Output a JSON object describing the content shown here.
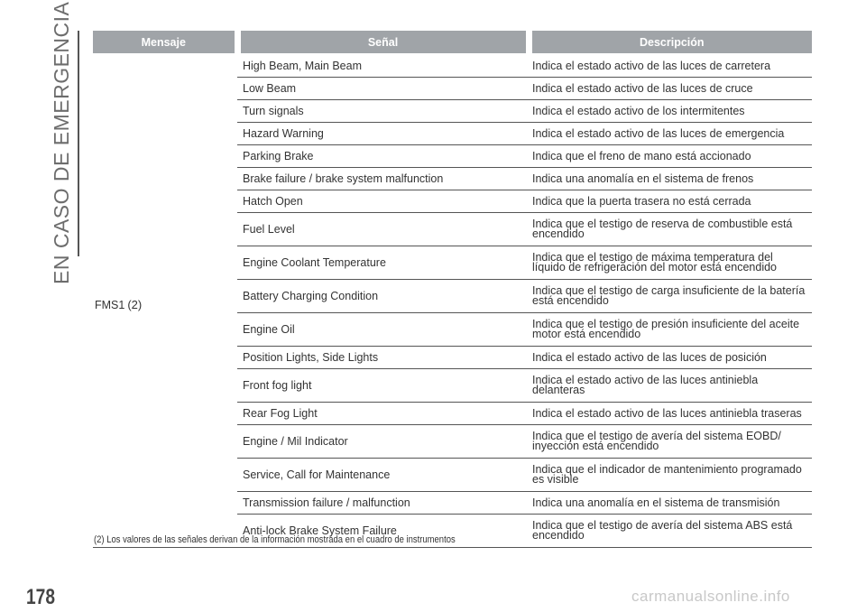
{
  "section_title": "EN CASO DE EMERGENCIA",
  "headers": [
    "Mensaje",
    "Señal",
    "Descripción"
  ],
  "message_label": "FMS1",
  "message_ref": "(2)",
  "rows": [
    {
      "signal": "High Beam, Main Beam",
      "description": "Indica el estado activo de las luces de carretera"
    },
    {
      "signal": "Low Beam",
      "description": "Indica el estado activo de las luces de cruce"
    },
    {
      "signal": "Turn signals",
      "description": "Indica el estado activo de los intermitentes"
    },
    {
      "signal": "Hazard Warning",
      "description": "Indica el estado activo de las luces de emergencia"
    },
    {
      "signal": "Parking Brake",
      "description": "Indica que el freno de mano está accionado"
    },
    {
      "signal": "Brake failure / brake system malfunction",
      "description": "Indica una anomalía en el sistema de frenos"
    },
    {
      "signal": "Hatch Open",
      "description": "Indica que la puerta trasera no está cerrada"
    },
    {
      "signal": "Fuel Level",
      "description": "Indica que el testigo de reserva de combustible está encendido"
    },
    {
      "signal": "Engine Coolant Temperature",
      "description": "Indica que el testigo de máxima temperatura del líquido de refrigeración del motor está encendido"
    },
    {
      "signal": "Battery Charging Condition",
      "description": "Indica que el testigo de carga insuficiente de la batería está encendido"
    },
    {
      "signal": "Engine Oil",
      "description": "Indica que el testigo de presión insuficiente del aceite motor está encendido"
    },
    {
      "signal": "Position Lights, Side Lights",
      "description": "Indica el estado activo de las luces de posición"
    },
    {
      "signal": "Front fog light",
      "description": "Indica el estado activo de las luces antiniebla delanteras"
    },
    {
      "signal": "Rear Fog Light",
      "description": "Indica el estado activo de las luces antiniebla traseras"
    },
    {
      "signal": "Engine / Mil Indicator",
      "description": "Indica que el testigo de avería del sistema EOBD/ inyección está encendido"
    },
    {
      "signal": "Service, Call for Maintenance",
      "description": "Indica que el indicador de mantenimiento programado es visible"
    },
    {
      "signal": "Transmission failure / malfunction",
      "description": "Indica una anomalía en el sistema de transmisión"
    },
    {
      "signal": "Anti-lock Brake System Failure",
      "description": "Indica que el testigo de avería del sistema ABS está encendido"
    }
  ],
  "footnote": "(2) Los valores de las señales derivan de la información mostrada en el cuadro de instrumentos",
  "page_number": "178",
  "watermark": "carmanualsonline.info"
}
